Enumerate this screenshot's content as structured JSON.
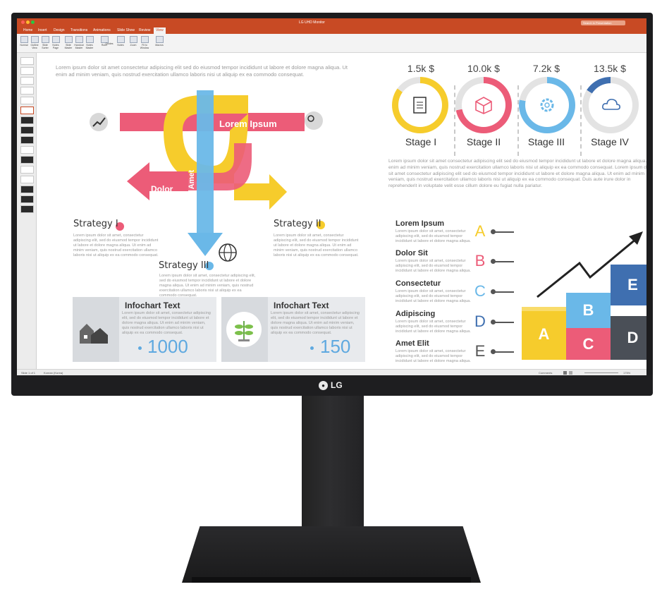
{
  "app": {
    "window_title": "LG UHD Monitor",
    "search_placeholder": "Search in Presentation",
    "tabs": [
      "Home",
      "Insert",
      "Design",
      "Transitions",
      "Animations",
      "Slide Show",
      "Review",
      "View"
    ],
    "active_tab": "View",
    "ribbon_buttons": [
      "Normal",
      "Outline View",
      "Slide Sorter",
      "Notes Page",
      "Slide Master",
      "Handout Master",
      "Notes Master",
      "Ruler",
      "Guides",
      "Notes",
      "Zoom",
      "Fit to Window",
      "Macros"
    ],
    "status_left": "Slide 1 of 1",
    "status_lang": "Korean (Korea)",
    "status_comments": "Comments",
    "zoom": "175%"
  },
  "slide": {
    "intro": "Lorem ipsum dolor sit amet consectetur adipiscing elit sed do eiusmod tempor incididunt ut labore et dolore magna aliqua. Ut enim ad minim veniam, quis nostrud exercitation ullamco laboris nisi ut aliquip ex ea commodo consequat.",
    "banner": "Lorem Ipsum",
    "arrow_left": "Dolor",
    "arrow_down": "Sit Amet",
    "strategy1": "Strategy I",
    "strategy2": "Strategy II",
    "strategy3": "Strategy III",
    "strategy_text": "Lorem ipsum dolor sit amet, consectetur adipiscing elit, sed do eiusmod tempor incididunt ut labore et dolore magna aliqua. Ut enim ad minim veniam, quis nostrud exercitation ullamco laboris nisi ut aliquip ex ea commodo consequat.",
    "stages": [
      {
        "value": "1.5k $",
        "label": "Stage I",
        "color": "#f6cc2c"
      },
      {
        "value": "10.0k $",
        "label": "Stage II",
        "color": "#ec5c78"
      },
      {
        "value": "7.2k $",
        "label": "Stage III",
        "color": "#6ab8e8"
      },
      {
        "value": "13.5k $",
        "label": "Stage IV",
        "color": "#3f6fb0"
      }
    ],
    "stage_text": "Lorem ipsum dolor sit amet consectetur adipiscing elit sed do eiusmod tempor incididunt ut labore et dolore magna aliqua. Ut enim ad minim veniam, quis nostrud exercitation ullamco laboris nisi ut aliquip ex ea commodo consequat. Lorem ipsum dolor sit amet consectetur adipiscing elit sed do eiusmod tempor incididunt ut labore et dolore magna aliqua. Ut enim ad minim veniam, quis nostrud exercitation ullamco laboris nisi ut aliquip ex ea commodo consequat. Duis aute irure dolor in reprehenderit in voluptate velit esse cillum dolore eu fugiat nulla pariatur.",
    "rows": [
      {
        "title": "Lorem Ipsum",
        "letter": "A",
        "color": "#f6cc2c"
      },
      {
        "title": "Dolor Sit",
        "letter": "B",
        "color": "#ec5c78"
      },
      {
        "title": "Consectetur",
        "letter": "C",
        "color": "#6ab8e8"
      },
      {
        "title": "Adipiscing",
        "letter": "D",
        "color": "#3f6fb0"
      },
      {
        "title": "Amet Elit",
        "letter": "E",
        "color": "#555555"
      }
    ],
    "row_text": "Lorem ipsum dolor sit amet, consectetur adipiscing elit, sed do eiusmod tempor incididunt ut labore et dolore magna aliqua.",
    "boxes": [
      "A",
      "B",
      "C",
      "D",
      "E"
    ],
    "cards": [
      {
        "title": "Infochart Text",
        "number": "1000"
      },
      {
        "title": "Infochart Text",
        "number": "150"
      }
    ],
    "card_text": "Lorem ipsum dolor sit amet, consectetur adipiscing elit, sed do eiusmod tempor incididunt ut labore et dolore magna aliqua. Ut enim ad minim veniam, quis nostrud exercitation ullamco laboris nisi ut aliquip ex ea commodo consequat."
  },
  "monitor": {
    "brand": "LG"
  }
}
